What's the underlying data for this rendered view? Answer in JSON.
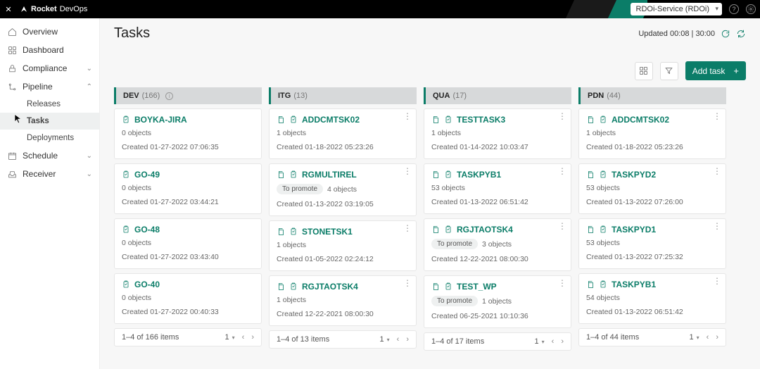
{
  "topbar": {
    "brand_a": "Rocket",
    "brand_b": "DevOps",
    "service": "RDOi-Service (RDOi)"
  },
  "sidebar": {
    "overview": "Overview",
    "dashboard": "Dashboard",
    "compliance": "Compliance",
    "pipeline": "Pipeline",
    "releases": "Releases",
    "tasks": "Tasks",
    "deployments": "Deployments",
    "schedule": "Schedule",
    "receiver": "Receiver"
  },
  "page": {
    "title": "Tasks",
    "updated": "Updated 00:08 | 30:00",
    "add_task": "Add task"
  },
  "columns": [
    {
      "name": "DEV",
      "count": "(166)",
      "info": true,
      "cards": [
        {
          "title": "BOYKA-JIRA",
          "objects": "0 objects",
          "created": "Created 01-27-2022 07:06:35"
        },
        {
          "title": "GO-49",
          "objects": "0 objects",
          "created": "Created 01-27-2022 03:44:21"
        },
        {
          "title": "GO-48",
          "objects": "0 objects",
          "created": "Created 01-27-2022 03:43:40"
        },
        {
          "title": "GO-40",
          "objects": "0 objects",
          "created": "Created 01-27-2022 00:40:33"
        }
      ],
      "pager": {
        "range": "1–4 of 166 items",
        "page": "1"
      }
    },
    {
      "name": "ITG",
      "count": "(13)",
      "cards": [
        {
          "title": "ADDCMTSK02",
          "objects": "1 objects",
          "created": "Created 01-18-2022 05:23:26",
          "dual": true
        },
        {
          "title": "RGMULTIREL",
          "badge": "To promote",
          "badge_count": "4 objects",
          "created": "Created 01-13-2022 03:19:05",
          "dual": true
        },
        {
          "title": "STONETSK1",
          "objects": "1 objects",
          "created": "Created 01-05-2022 02:24:12",
          "dual": true
        },
        {
          "title": "RGJTAOTSK4",
          "objects": "1 objects",
          "created": "Created 12-22-2021 08:00:30",
          "dual": true
        }
      ],
      "pager": {
        "range": "1–4 of 13 items",
        "page": "1"
      }
    },
    {
      "name": "QUA",
      "count": "(17)",
      "cards": [
        {
          "title": "TESTTASK3",
          "objects": "1 objects",
          "created": "Created 01-14-2022 10:03:47",
          "dual": true
        },
        {
          "title": "TASKPYB1",
          "objects": "53 objects",
          "created": "Created 01-13-2022 06:51:42",
          "dual": true
        },
        {
          "title": "RGJTAOTSK4",
          "badge": "To promote",
          "badge_count": "3 objects",
          "created": "Created 12-22-2021 08:00:30",
          "dual": true
        },
        {
          "title": "TEST_WP",
          "badge": "To promote",
          "badge_count": "1 objects",
          "created": "Created 06-25-2021 10:10:36",
          "dual": true
        }
      ],
      "pager": {
        "range": "1–4 of 17 items",
        "page": "1"
      }
    },
    {
      "name": "PDN",
      "count": "(44)",
      "cards": [
        {
          "title": "ADDCMTSK02",
          "objects": "1 objects",
          "created": "Created 01-18-2022 05:23:26",
          "dual": true
        },
        {
          "title": "TASKPYD2",
          "objects": "53 objects",
          "created": "Created 01-13-2022 07:26:00",
          "dual": true
        },
        {
          "title": "TASKPYD1",
          "objects": "53 objects",
          "created": "Created 01-13-2022 07:25:32",
          "dual": true
        },
        {
          "title": "TASKPYB1",
          "objects": "54 objects",
          "created": "Created 01-13-2022 06:51:42",
          "dual": true
        }
      ],
      "pager": {
        "range": "1–4 of 44 items",
        "page": "1"
      }
    }
  ]
}
